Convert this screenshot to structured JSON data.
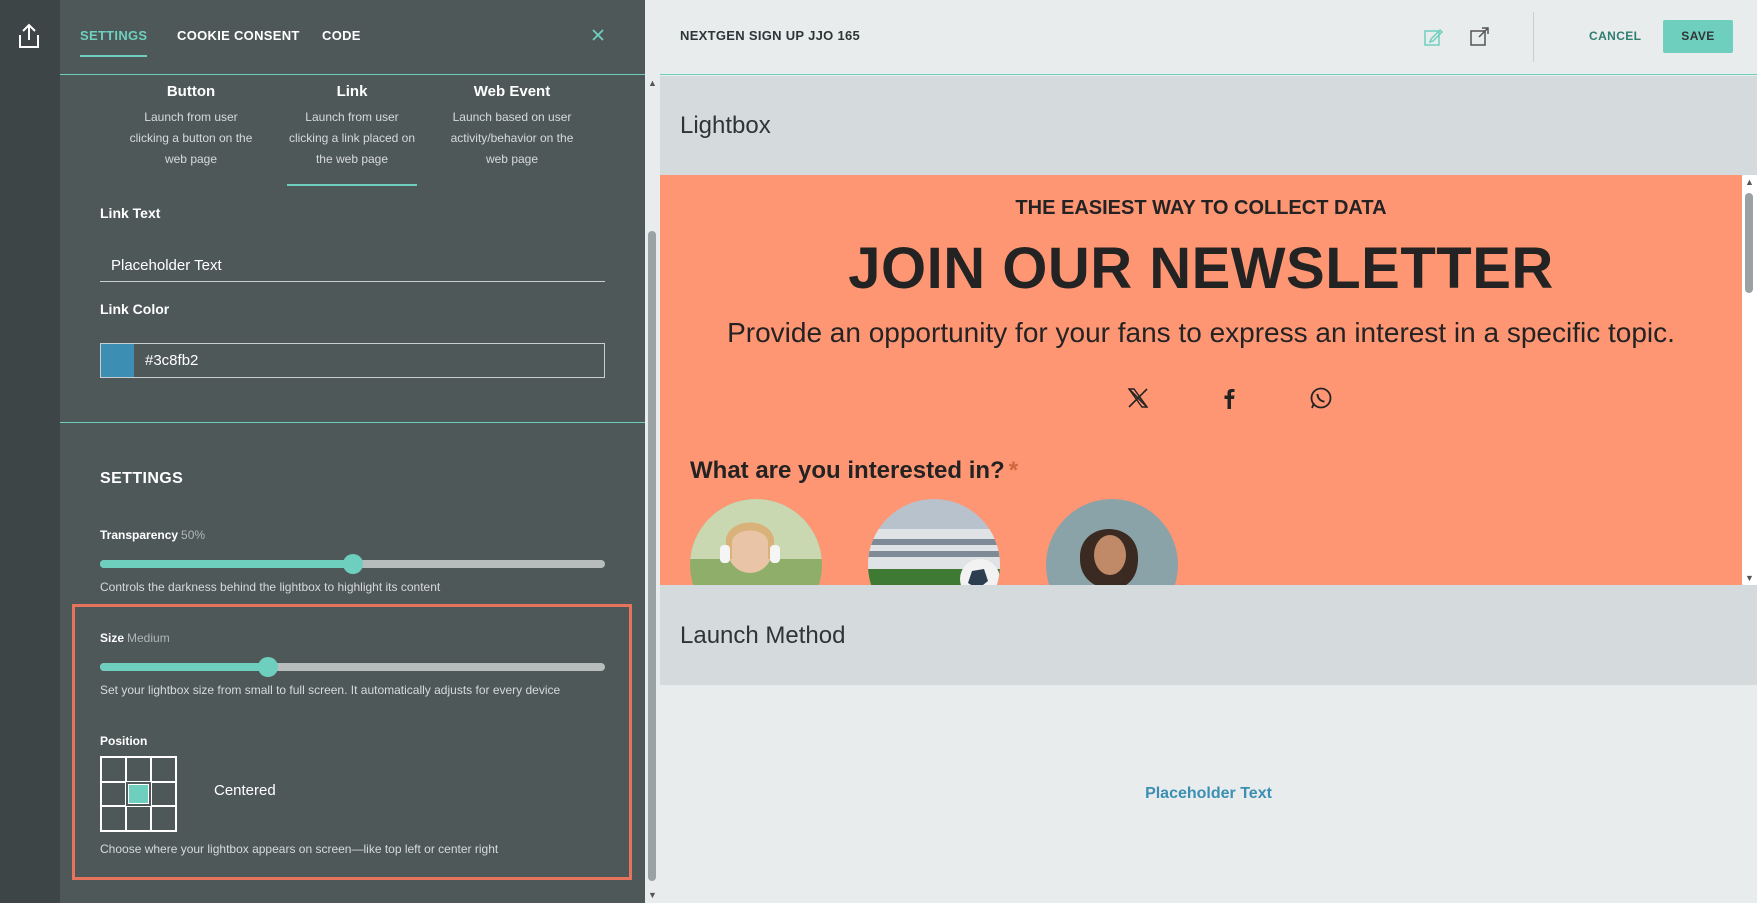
{
  "colors": {
    "accent": "#6fcfbf",
    "link_color": "#3c8fb2",
    "highlight": "#e8735d",
    "preview_bg": "#ff9673"
  },
  "panel": {
    "tabs": [
      {
        "label": "SETTINGS",
        "active": true
      },
      {
        "label": "COOKIE CONSENT",
        "active": false
      },
      {
        "label": "CODE",
        "active": false
      }
    ],
    "launch_methods": [
      {
        "title": "Button",
        "desc": "Launch from user clicking a button on the web page"
      },
      {
        "title": "Link",
        "desc": "Launch from user clicking a link placed on the web page",
        "active": true
      },
      {
        "title": "Web Event",
        "desc": "Launch based on user activity/behavior on the web page"
      }
    ],
    "link_text": {
      "label": "Link Text",
      "value": "Placeholder Text"
    },
    "link_color": {
      "label": "Link Color",
      "value": "#3c8fb2"
    },
    "settings_heading": "SETTINGS",
    "transparency": {
      "label": "Transparency",
      "value_text": "50%",
      "value": 0.5,
      "help": "Controls the darkness behind the lightbox to highlight its content"
    },
    "size": {
      "label": "Size",
      "value_text": "Medium",
      "value": 0.333,
      "help": "Set your lightbox size from small to full screen. It automatically adjusts for every device"
    },
    "position": {
      "label": "Position",
      "value": "Centered",
      "selected_cell": 4,
      "help": "Choose where your lightbox appears on screen—like top left or center right"
    }
  },
  "topbar": {
    "title": "NEXTGEN SIGN UP JJO 165",
    "cancel": "CANCEL",
    "save": "SAVE"
  },
  "sections": {
    "lightbox": "Lightbox",
    "launch_method": "Launch Method"
  },
  "preview": {
    "eyebrow": "THE EASIEST WAY TO COLLECT DATA",
    "headline": "JOIN OUR NEWSLETTER",
    "subhead": "Provide an opportunity for your fans to express an interest in a specific topic.",
    "social_icons": [
      "x-icon",
      "facebook-icon",
      "whatsapp-icon"
    ],
    "question": "What are you interested in?",
    "required_mark": "*"
  },
  "launch_preview": {
    "link_text": "Placeholder Text"
  }
}
